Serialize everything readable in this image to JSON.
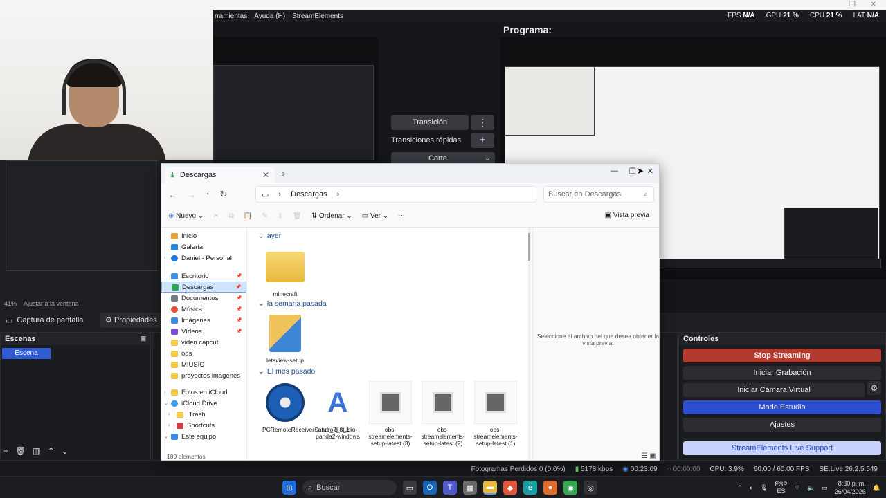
{
  "obs": {
    "menu": [
      "rramientas",
      "Ayuda (H)",
      "StreamElements"
    ],
    "stats": [
      {
        "label": "FPS",
        "value": "N/A"
      },
      {
        "label": "GPU",
        "value": "21 %"
      },
      {
        "label": "CPU",
        "value": "21 %"
      },
      {
        "label": "LAT",
        "value": "N/A"
      }
    ],
    "program_label": "Programa:",
    "transition": {
      "label": "Transición",
      "quick": "Transiciones rápidas",
      "cut": "Corte"
    },
    "zoom": {
      "percent": "41%",
      "fit": "Ajustar a la ventana"
    },
    "source": {
      "label": "Captura de pantalla",
      "properties": "Propiedades"
    },
    "scenes": {
      "title": "Escenas",
      "items": [
        "Escena"
      ]
    },
    "controls": {
      "title": "Controles",
      "stop_streaming": "Stop Streaming",
      "start_recording": "Iniciar Grabación",
      "virtual_cam": "Iniciar Cámara Virtual",
      "studio_mode": "Modo Estudio",
      "settings": "Ajustes",
      "support": "StreamElements Live Support"
    },
    "status": {
      "dropped": "Fotogramas Perdidos 0 (0.0%)",
      "bitrate": "5178 kbps",
      "live_time": "00:23:09",
      "rec_time": "00:00:00",
      "cpu": "CPU: 3.9%",
      "fps": "60.00 / 60.00 FPS",
      "version": "SE.Live 26.2.5.549"
    }
  },
  "explorer": {
    "tab_title": "Descargas",
    "breadcrumb": "Descargas",
    "search_placeholder": "Buscar en Descargas",
    "toolbar": {
      "new": "Nuevo",
      "sort": "Ordenar",
      "view": "Ver",
      "preview": "Vista previa"
    },
    "sidebar": [
      {
        "label": "Inicio",
        "color": "#e5a13a"
      },
      {
        "label": "Galería",
        "color": "#2b88d8"
      },
      {
        "label": "Daniel - Personal",
        "color": "#1f7ae0"
      },
      {
        "label": "Escritorio",
        "color": "#3d8ee8"
      },
      {
        "label": "Descargas",
        "color": "#2aa64f"
      },
      {
        "label": "Documentos",
        "color": "#6f7b8a"
      },
      {
        "label": "Música",
        "color": "#e2553b"
      },
      {
        "label": "Imágenes",
        "color": "#3c8de0"
      },
      {
        "label": "Vídeos",
        "color": "#7b4fd6"
      },
      {
        "label": "video capcut",
        "color": "#f2c94c"
      },
      {
        "label": "obs",
        "color": "#f2c94c"
      },
      {
        "label": "MIUSIC",
        "color": "#f2c94c"
      },
      {
        "label": "proyectos imagenes",
        "color": "#f2c94c"
      },
      {
        "label": "Fotos en iCloud",
        "color": "#f2c94c"
      },
      {
        "label": "iCloud Drive",
        "color": "#3c9bea"
      },
      {
        "label": ".Trash",
        "color": "#f2c94c"
      },
      {
        "label": "Shortcuts",
        "color": "#d33e4a"
      },
      {
        "label": "Este equipo",
        "color": "#3c8de0"
      }
    ],
    "groups": {
      "yesterday": "ayer",
      "last_week": "la semana pasada",
      "last_month": "El mes pasado"
    },
    "files": {
      "minecraft": "minecraft",
      "letsview": "letsview-setup",
      "pcremote": "PCRemoteReceiverSetup_7_8_1",
      "android": "android-studio-panda2-windows",
      "obs3": "obs-streamelements-setup-latest (3)",
      "obs2": "obs-streamelements-setup-latest (2)",
      "obs1": "obs-streamelements-setup-latest (1)"
    },
    "preview_message": "Seleccione el archivo del que desea obtener la vista previa.",
    "item_count": "189 elementos"
  },
  "taskbar": {
    "search": "Buscar",
    "lang_top": "ESP",
    "lang_bottom": "ES",
    "time": "8:30 p. m.",
    "date": "26/04/2026"
  }
}
